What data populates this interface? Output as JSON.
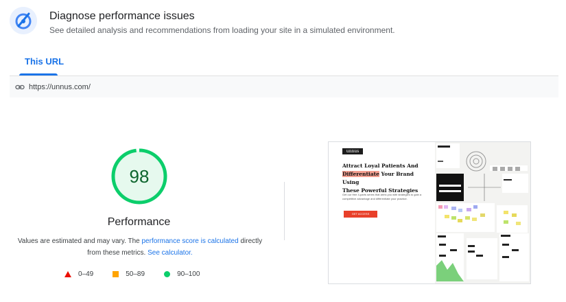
{
  "header": {
    "icon": "speedometer-icon",
    "title": "Diagnose performance issues",
    "subtitle": "See detailed analysis and recommendations from loading your site in a simulated environment."
  },
  "tabs": [
    {
      "label": "This URL",
      "active": true
    }
  ],
  "url_bar": {
    "icon": "link-icon",
    "url": "https://unnus.com/"
  },
  "score": {
    "value": "98",
    "fraction": 0.98,
    "label": "Performance",
    "note_prefix": "Values are estimated and may vary. The ",
    "note_link1": "performance score is calculated",
    "note_middle": " directly from these metrics. ",
    "note_link2": "See calculator.",
    "color": "#0cce6b",
    "text_color": "#0d652d"
  },
  "legend": [
    {
      "icon": "triangle-icon",
      "range": "0–49",
      "color": "#eb0f00"
    },
    {
      "icon": "square-icon",
      "range": "50–89",
      "color": "#ffa400"
    },
    {
      "icon": "circle-icon",
      "range": "90–100",
      "color": "#0cce6b"
    }
  ],
  "screenshot": {
    "logo": "unnus",
    "headline_1": "Attract Loyal Patients And",
    "headline_2_mark": "Differentiate",
    "headline_2_rest": " Your Brand Using",
    "headline_3": "These Powerful Strategies",
    "body": "Get our free 4-parts series that arms you with strategies to gain a competitive advantage and differentiate your practice.",
    "cta": "GET ACCESS"
  }
}
